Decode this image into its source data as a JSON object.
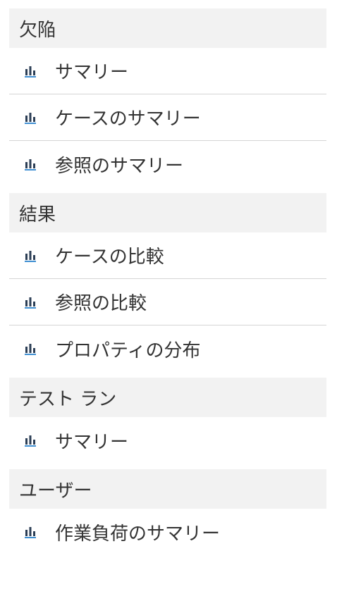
{
  "colors": {
    "section_bg": "#f2f2f2",
    "divider": "#d4d4d4",
    "text": "#333333",
    "icon_dark": "#2c3e55",
    "icon_accent": "#3f8fd2"
  },
  "icon": "bar-chart-icon",
  "sections": [
    {
      "title": "欠陥",
      "items": [
        {
          "label": "サマリー"
        },
        {
          "label": "ケースのサマリー"
        },
        {
          "label": "参照のサマリー"
        }
      ]
    },
    {
      "title": "結果",
      "items": [
        {
          "label": "ケースの比較"
        },
        {
          "label": "参照の比較"
        },
        {
          "label": "プロパティの分布"
        }
      ]
    },
    {
      "title": "テスト ラン",
      "items": [
        {
          "label": "サマリー"
        }
      ]
    },
    {
      "title": "ユーザー",
      "items": [
        {
          "label": "作業負荷のサマリー"
        }
      ]
    }
  ]
}
